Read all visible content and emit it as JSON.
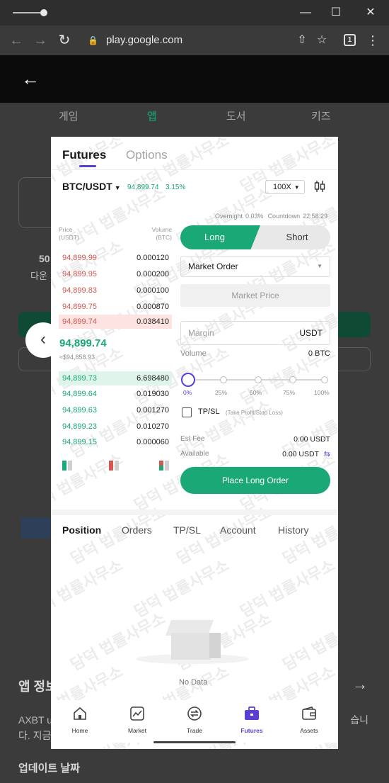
{
  "browser": {
    "url": "play.google.com",
    "tab_count": "1",
    "win_minimize": "—",
    "win_maximize": "☐",
    "win_close": "✕"
  },
  "store": {
    "tabs": [
      "게임",
      "앱",
      "도서",
      "키즈"
    ],
    "active_tab": "앱",
    "stat_value": "50",
    "stat_label": "다운",
    "section_title": "앱 정보",
    "description_start": "AXBT u",
    "description_end": "습니",
    "description_line2": "다. 지금",
    "update_heading": "업데이트 날짜"
  },
  "app": {
    "top_tabs": [
      "Futures",
      "Options"
    ],
    "pair": "BTC/USDT",
    "last_price": "94,899.74",
    "change_pct": "3.15%",
    "leverage": "100X",
    "overnight_label": "Overnight",
    "overnight_value": "0.03%",
    "countdown_label": "Countdown",
    "countdown_value": "22:58:29",
    "orderbook": {
      "price_header": "Price",
      "price_unit": "(USDT)",
      "volume_header": "Volume",
      "volume_unit": "(BTC)",
      "asks": [
        {
          "price": "94,899.99",
          "volume": "0.000120"
        },
        {
          "price": "94,899.95",
          "volume": "0.000200"
        },
        {
          "price": "94,899.83",
          "volume": "0.000100"
        },
        {
          "price": "94,899.75",
          "volume": "0.000870"
        },
        {
          "price": "94,899.74",
          "volume": "0.038410"
        }
      ],
      "mid_price": "94,899.74",
      "mid_sub": "≈$94,858.93",
      "bids": [
        {
          "price": "94,899.73",
          "volume": "6.698480"
        },
        {
          "price": "94,899.64",
          "volume": "0.019030"
        },
        {
          "price": "94,899.63",
          "volume": "0.001270"
        },
        {
          "price": "94,899.23",
          "volume": "0.010270"
        },
        {
          "price": "94,899.15",
          "volume": "0.000060"
        }
      ]
    },
    "form": {
      "long_label": "Long",
      "short_label": "Short",
      "order_type": "Market Order",
      "market_price_label": "Market Price",
      "margin_placeholder": "Margin",
      "margin_unit": "USDT",
      "volume_label": "Volume",
      "volume_value": "0 BTC",
      "slider_value_pct": 0,
      "slider_marks": [
        "0%",
        "25%",
        "50%",
        "75%",
        "100%"
      ],
      "tpsl_label": "TP/SL",
      "tpsl_note": "(Take Profit/Stop Loss)",
      "fee_label": "Est Fee",
      "fee_value": "0.00 USDT",
      "available_label": "Available",
      "available_value": "0.00 USDT",
      "place_label": "Place Long Order"
    },
    "bottom_tabs": [
      "Position",
      "Orders",
      "TP/SL",
      "Account",
      "History"
    ],
    "empty_text": "No Data",
    "nav": [
      {
        "label": "Home",
        "icon": "home-icon"
      },
      {
        "label": "Market",
        "icon": "chart-icon"
      },
      {
        "label": "Trade",
        "icon": "swap-icon"
      },
      {
        "label": "Futures",
        "icon": "briefcase-icon"
      },
      {
        "label": "Assets",
        "icon": "wallet-icon"
      }
    ],
    "active_nav": "Futures"
  },
  "watermark_text": "담덕 법률사무소",
  "colors": {
    "accent_green": "#1aa877",
    "accent_purple": "#5b3fd2",
    "ask_red": "#d4574f"
  }
}
